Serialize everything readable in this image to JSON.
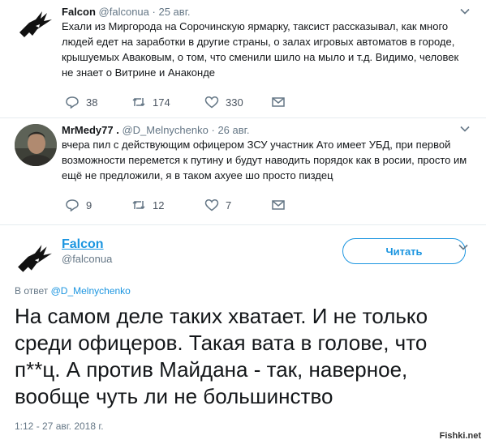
{
  "tweets": [
    {
      "name": "Falcon",
      "handle": "@falconua",
      "dot": "·",
      "date": "25 авг.",
      "text": "Ехали из Миргорода на Сорочинскую ярмарку, таксист рассказывал, как много людей едет на заработки в другие страны, о залах игровых автоматов в городе, крышуемых Аваковым, о том, что сменили шило на мыло и т.д. Видимо, человек не знает о Витрине и Анаконде",
      "replies": "38",
      "retweets": "174",
      "likes": "330"
    },
    {
      "name": "MrMedy77 .",
      "handle": "@D_Melnychenko",
      "dot": "·",
      "date": "26 авг.",
      "text": "вчера пил с действующим офицером ЗСУ участник Ато имеет УБД, при первой возможности перемется к путину и будут наводить порядок как в росии, просто им ещё не предложили, я в таком ахуее шо просто пиздец",
      "replies": "9",
      "retweets": "12",
      "likes": "7"
    }
  ],
  "main": {
    "name": "Falcon",
    "handle": "@falconua",
    "follow_label": "Читать",
    "reply_prefix": "В ответ",
    "reply_handle": "@D_Melnychenko",
    "text": "На самом деле таких хватает. И не только среди офицеров. Такая вата в голове, что п**ц. А против Майдана - так, наверное, вообще чуть ли не большинство",
    "timestamp": "1:12 - 27 авг. 2018 г."
  },
  "watermark": "Fishki.net",
  "colors": {
    "accent": "#1b95e0",
    "muted": "#657786",
    "text": "#14171a"
  }
}
